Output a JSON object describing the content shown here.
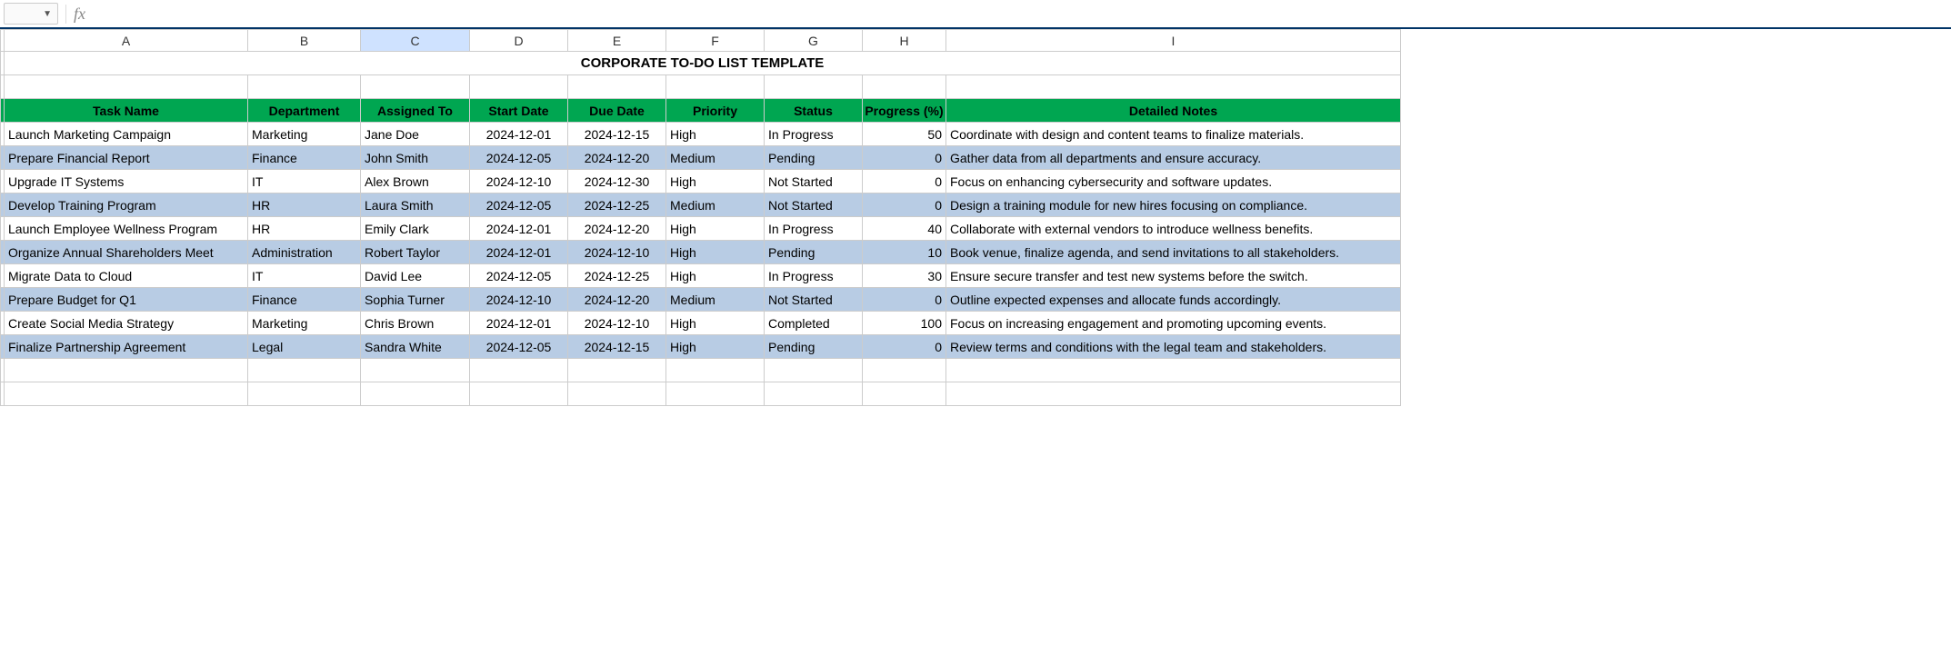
{
  "formula_bar": {
    "fx": "fx",
    "value": ""
  },
  "columns": [
    "A",
    "B",
    "C",
    "D",
    "E",
    "F",
    "G",
    "H",
    "I"
  ],
  "selected_column": "C",
  "title": "CORPORATE TO-DO LIST TEMPLATE",
  "headers": [
    "Task Name",
    "Department",
    "Assigned To",
    "Start Date",
    "Due Date",
    "Priority",
    "Status",
    "Progress (%)",
    "Detailed Notes"
  ],
  "rows": [
    {
      "task": "Launch Marketing Campaign",
      "dept": "Marketing",
      "assigned": "Jane Doe",
      "start": "2024-12-01",
      "due": "2024-12-15",
      "priority": "High",
      "status": "In Progress",
      "progress": "50",
      "notes": "Coordinate with design and content teams to finalize materials."
    },
    {
      "task": "Prepare Financial Report",
      "dept": "Finance",
      "assigned": "John Smith",
      "start": "2024-12-05",
      "due": "2024-12-20",
      "priority": "Medium",
      "status": "Pending",
      "progress": "0",
      "notes": "Gather data from all departments and ensure accuracy."
    },
    {
      "task": "Upgrade IT Systems",
      "dept": "IT",
      "assigned": "Alex Brown",
      "start": "2024-12-10",
      "due": "2024-12-30",
      "priority": "High",
      "status": "Not Started",
      "progress": "0",
      "notes": "Focus on enhancing cybersecurity and software updates."
    },
    {
      "task": "Develop Training Program",
      "dept": "HR",
      "assigned": "Laura Smith",
      "start": "2024-12-05",
      "due": "2024-12-25",
      "priority": "Medium",
      "status": "Not Started",
      "progress": "0",
      "notes": "Design a training module for new hires focusing on compliance."
    },
    {
      "task": "Launch Employee Wellness Program",
      "dept": "HR",
      "assigned": "Emily Clark",
      "start": "2024-12-01",
      "due": "2024-12-20",
      "priority": "High",
      "status": "In Progress",
      "progress": "40",
      "notes": "Collaborate with external vendors to introduce wellness benefits."
    },
    {
      "task": "Organize Annual Shareholders Meet",
      "dept": "Administration",
      "assigned": "Robert Taylor",
      "start": "2024-12-01",
      "due": "2024-12-10",
      "priority": "High",
      "status": "Pending",
      "progress": "10",
      "notes": "Book venue, finalize agenda, and send invitations to all stakeholders."
    },
    {
      "task": "Migrate Data to Cloud",
      "dept": "IT",
      "assigned": "David Lee",
      "start": "2024-12-05",
      "due": "2024-12-25",
      "priority": "High",
      "status": "In Progress",
      "progress": "30",
      "notes": "Ensure secure transfer and test new systems before the switch."
    },
    {
      "task": "Prepare Budget for Q1",
      "dept": "Finance",
      "assigned": "Sophia Turner",
      "start": "2024-12-10",
      "due": "2024-12-20",
      "priority": "Medium",
      "status": "Not Started",
      "progress": "0",
      "notes": "Outline expected expenses and allocate funds accordingly."
    },
    {
      "task": "Create Social Media Strategy",
      "dept": "Marketing",
      "assigned": "Chris Brown",
      "start": "2024-12-01",
      "due": "2024-12-10",
      "priority": "High",
      "status": "Completed",
      "progress": "100",
      "notes": "Focus on increasing engagement and promoting upcoming events."
    },
    {
      "task": "Finalize Partnership Agreement",
      "dept": "Legal",
      "assigned": "Sandra White",
      "start": "2024-12-05",
      "due": "2024-12-15",
      "priority": "High",
      "status": "Pending",
      "progress": "0",
      "notes": "Review terms and conditions with the legal team and stakeholders."
    }
  ]
}
